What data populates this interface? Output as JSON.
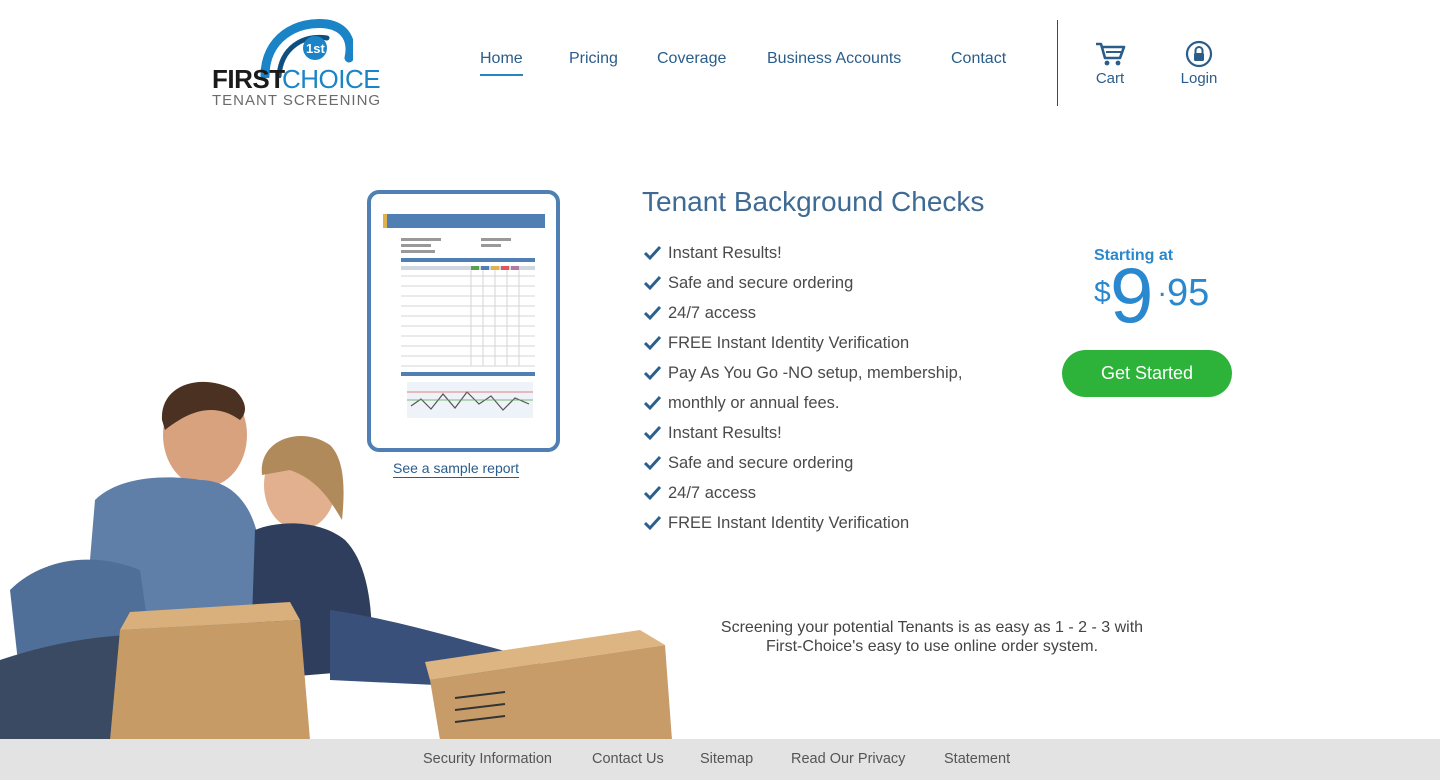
{
  "brand": {
    "name_first": "FIRST",
    "name_second": "CHOICE",
    "subtitle": "TENANT SCREENING",
    "badge_text": "1st"
  },
  "nav": {
    "items": [
      {
        "label": "Home",
        "active": true
      },
      {
        "label": "Pricing",
        "active": false
      },
      {
        "label": "Coverage",
        "active": false
      },
      {
        "label": "Business Accounts",
        "active": false
      },
      {
        "label": "Contact",
        "active": false
      }
    ]
  },
  "utility": {
    "cart_label": "Cart",
    "cart_icon": "cart-icon",
    "login_label": "Login",
    "login_icon": "lock-icon"
  },
  "report": {
    "link_label": "See a sample report"
  },
  "main": {
    "title": "Tenant Background Checks",
    "features": [
      "Instant Results!",
      "Safe and secure ordering",
      "24/7 access",
      "FREE Instant Identity Verification",
      "Pay As You Go -NO setup, membership,",
      "monthly or annual fees.",
      "Instant Results!",
      "Safe and secure ordering",
      "24/7 access",
      "FREE Instant Identity Verification"
    ],
    "tagline_line1": "Screening your potential Tenants is as easy as 1 - 2 - 3 with",
    "tagline_line2": "First-Choice's easy to use online order system."
  },
  "pricing": {
    "label": "Starting at",
    "currency": "$",
    "whole": "9",
    "decimal": ".",
    "cents": "95",
    "cta_label": "Get Started"
  },
  "footer": {
    "links": [
      "Security Information",
      "Contact Us",
      "Sitemap",
      "Read Our Privacy",
      "Statement"
    ]
  },
  "colors": {
    "accent_blue": "#2a88cf",
    "nav_blue": "#2a5d8a",
    "cta_green": "#2eb33a",
    "footer_bg": "#e3e3e3"
  }
}
